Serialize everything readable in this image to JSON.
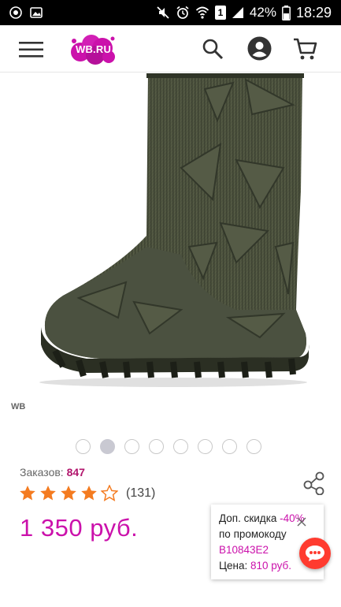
{
  "status_bar": {
    "battery": "42%",
    "time": "18:29",
    "sim": "1"
  },
  "header": {
    "logo_text": "WB.RU",
    "icons": [
      "menu-icon",
      "search-icon",
      "account-icon",
      "cart-icon"
    ]
  },
  "product": {
    "brand": "WB",
    "gallery": {
      "total": 8,
      "active_index": 1
    },
    "orders_label": "Заказов:",
    "orders_count": "847",
    "rating": {
      "stars_filled": 4,
      "stars_total": 5,
      "reviews": "(131)"
    },
    "price": "1 350 руб."
  },
  "promo": {
    "line1": "Доп. скидка",
    "discount": "-40%",
    "line2": "по промокоду",
    "code": "B10843E2",
    "price_label": "Цена:",
    "price_value": "810 руб."
  },
  "colors": {
    "brand_accent": "#cb11ab",
    "orders_accent": "#b2166d",
    "star": "#f47b20",
    "chat": "#ff3b2f"
  }
}
